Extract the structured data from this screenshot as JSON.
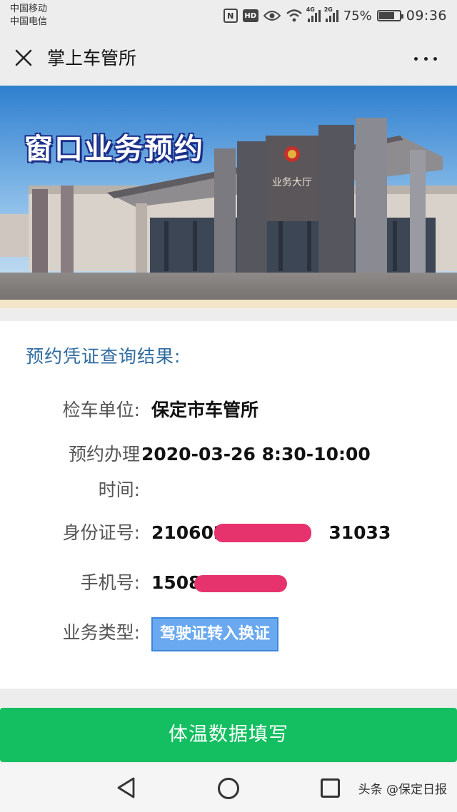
{
  "status_bar": {
    "carrier_1": "中国移动",
    "carrier_2": "中国电信",
    "nfc": "N",
    "hd": "HD",
    "network_1": "4G",
    "network_2": "2G",
    "battery_percent": "75%",
    "battery_level": 0.75,
    "time": "09:36"
  },
  "header": {
    "title": "掌上车管所",
    "close_icon": "close-icon",
    "more_icon": "more-icon"
  },
  "banner": {
    "title": "窗口业务预约",
    "building_sign": "业务大厅"
  },
  "result": {
    "title": "预约凭证查询结果:",
    "rows": [
      {
        "label": "检车单位:",
        "value": "保定市车管所"
      },
      {
        "label": "预约办理时间:",
        "value": "2020-03-26 8:30-10:00"
      },
      {
        "label": "身份证号:",
        "value_prefix": "210602",
        "value_suffix": "31033"
      },
      {
        "label": "手机号:",
        "value_prefix": "1508"
      },
      {
        "label": "业务类型:",
        "value": "驾驶证转入换证"
      }
    ]
  },
  "buttons": {
    "submit": "体温数据填写"
  },
  "colors": {
    "primary_green": "#13bf60",
    "title_blue": "#2f6b9f",
    "tag_blue": "#6aa9ef",
    "redaction_pink": "#e6336e"
  },
  "watermark": "头条 @保定日报"
}
